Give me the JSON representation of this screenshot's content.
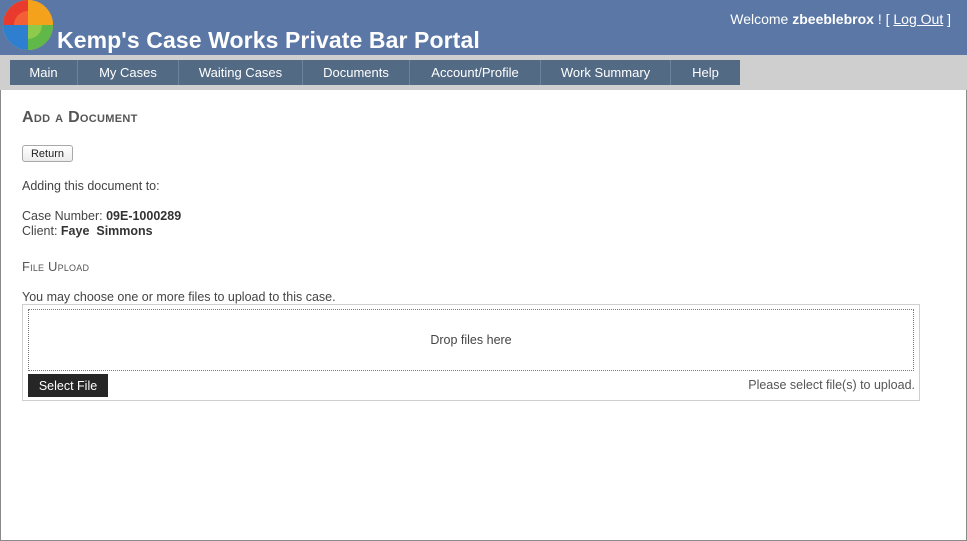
{
  "header": {
    "title": "Kemp's Case Works Private Bar Portal",
    "welcome_prefix": "Welcome",
    "username": "zbeeblebrox",
    "welcome_suffix": "! [",
    "logout_label": "Log Out",
    "logout_close": "]"
  },
  "nav": {
    "items": [
      {
        "label": "Main"
      },
      {
        "label": "My Cases"
      },
      {
        "label": "Waiting Cases"
      },
      {
        "label": "Documents"
      },
      {
        "label": "Account/Profile"
      },
      {
        "label": "Work Summary"
      },
      {
        "label": "Help"
      }
    ]
  },
  "page": {
    "title": "Add a Document",
    "return_label": "Return",
    "adding_text": "Adding this document to:",
    "case_number_label": "Case Number:",
    "case_number": "09E-1000289",
    "client_label": "Client:",
    "client_name": "Faye  Simmons"
  },
  "upload": {
    "section_title": "File Upload",
    "instructions": "You may choose one or more files to upload to this case.",
    "drop_text": "Drop files here",
    "select_label": "Select File",
    "status_text": "Please select file(s) to upload."
  },
  "colors": {
    "header_bg": "#5a77a6",
    "nav_bg": "#536a85",
    "navbar_strip": "#cfcfcf",
    "select_button_bg": "#262626"
  },
  "icons": {
    "logo": "four-color-quadrant-logo"
  }
}
